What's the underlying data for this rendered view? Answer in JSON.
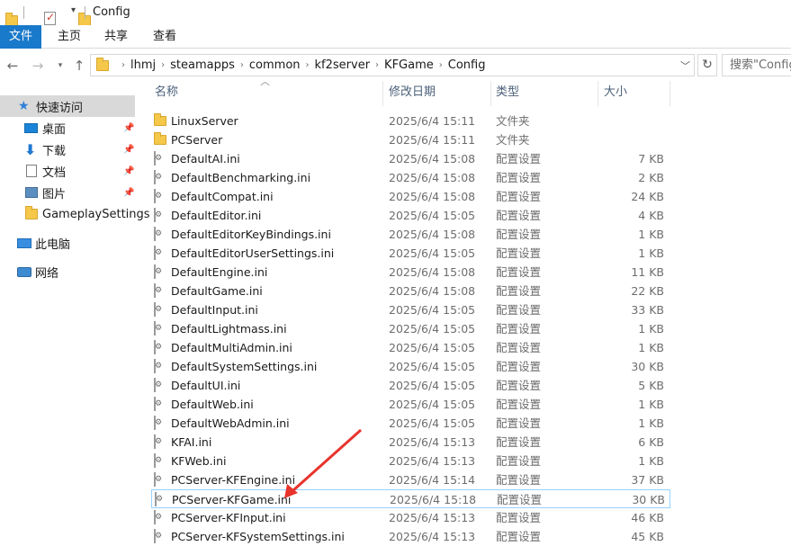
{
  "window": {
    "title": "Config"
  },
  "ribbon": {
    "tabs": [
      "文件",
      "主页",
      "共享",
      "查看"
    ]
  },
  "address": {
    "crumbs": [
      "lhmj",
      "steamapps",
      "common",
      "kf2server",
      "KFGame",
      "Config"
    ],
    "search_placeholder": "搜索\"Config\""
  },
  "sidebar": {
    "quick_access": "快速访问",
    "items": [
      {
        "label": "桌面",
        "icon": "desktop-icon",
        "pinned": true
      },
      {
        "label": "下载",
        "icon": "download-icon",
        "pinned": true
      },
      {
        "label": "文档",
        "icon": "documents-icon",
        "pinned": true
      },
      {
        "label": "图片",
        "icon": "pictures-icon",
        "pinned": true
      },
      {
        "label": "GameplaySettings",
        "icon": "folder-icon",
        "pinned": false
      }
    ],
    "this_pc": "此电脑",
    "network": "网络"
  },
  "columns": {
    "name": "名称",
    "date": "修改日期",
    "type": "类型",
    "size": "大小"
  },
  "files": [
    {
      "name": "LinuxServer",
      "date": "2025/6/4 15:11",
      "type": "文件夹",
      "size": "",
      "kind": "folder"
    },
    {
      "name": "PCServer",
      "date": "2025/6/4 15:11",
      "type": "文件夹",
      "size": "",
      "kind": "folder"
    },
    {
      "name": "DefaultAI.ini",
      "date": "2025/6/4 15:08",
      "type": "配置设置",
      "size": "7 KB",
      "kind": "ini"
    },
    {
      "name": "DefaultBenchmarking.ini",
      "date": "2025/6/4 15:08",
      "type": "配置设置",
      "size": "2 KB",
      "kind": "ini"
    },
    {
      "name": "DefaultCompat.ini",
      "date": "2025/6/4 15:08",
      "type": "配置设置",
      "size": "24 KB",
      "kind": "ini"
    },
    {
      "name": "DefaultEditor.ini",
      "date": "2025/6/4 15:05",
      "type": "配置设置",
      "size": "4 KB",
      "kind": "ini"
    },
    {
      "name": "DefaultEditorKeyBindings.ini",
      "date": "2025/6/4 15:08",
      "type": "配置设置",
      "size": "1 KB",
      "kind": "ini"
    },
    {
      "name": "DefaultEditorUserSettings.ini",
      "date": "2025/6/4 15:05",
      "type": "配置设置",
      "size": "1 KB",
      "kind": "ini"
    },
    {
      "name": "DefaultEngine.ini",
      "date": "2025/6/4 15:08",
      "type": "配置设置",
      "size": "11 KB",
      "kind": "ini"
    },
    {
      "name": "DefaultGame.ini",
      "date": "2025/6/4 15:08",
      "type": "配置设置",
      "size": "22 KB",
      "kind": "ini"
    },
    {
      "name": "DefaultInput.ini",
      "date": "2025/6/4 15:05",
      "type": "配置设置",
      "size": "33 KB",
      "kind": "ini"
    },
    {
      "name": "DefaultLightmass.ini",
      "date": "2025/6/4 15:05",
      "type": "配置设置",
      "size": "1 KB",
      "kind": "ini"
    },
    {
      "name": "DefaultMultiAdmin.ini",
      "date": "2025/6/4 15:05",
      "type": "配置设置",
      "size": "1 KB",
      "kind": "ini"
    },
    {
      "name": "DefaultSystemSettings.ini",
      "date": "2025/6/4 15:05",
      "type": "配置设置",
      "size": "30 KB",
      "kind": "ini"
    },
    {
      "name": "DefaultUI.ini",
      "date": "2025/6/4 15:05",
      "type": "配置设置",
      "size": "5 KB",
      "kind": "ini"
    },
    {
      "name": "DefaultWeb.ini",
      "date": "2025/6/4 15:05",
      "type": "配置设置",
      "size": "1 KB",
      "kind": "ini"
    },
    {
      "name": "DefaultWebAdmin.ini",
      "date": "2025/6/4 15:05",
      "type": "配置设置",
      "size": "1 KB",
      "kind": "ini"
    },
    {
      "name": "KFAI.ini",
      "date": "2025/6/4 15:13",
      "type": "配置设置",
      "size": "6 KB",
      "kind": "ini"
    },
    {
      "name": "KFWeb.ini",
      "date": "2025/6/4 15:13",
      "type": "配置设置",
      "size": "1 KB",
      "kind": "ini"
    },
    {
      "name": "PCServer-KFEngine.ini",
      "date": "2025/6/4 15:14",
      "type": "配置设置",
      "size": "37 KB",
      "kind": "ini"
    },
    {
      "name": "PCServer-KFGame.ini",
      "date": "2025/6/4 15:18",
      "type": "配置设置",
      "size": "30 KB",
      "kind": "ini",
      "selected": true
    },
    {
      "name": "PCServer-KFInput.ini",
      "date": "2025/6/4 15:13",
      "type": "配置设置",
      "size": "46 KB",
      "kind": "ini"
    },
    {
      "name": "PCServer-KFSystemSettings.ini",
      "date": "2025/6/4 15:13",
      "type": "配置设置",
      "size": "45 KB",
      "kind": "ini"
    }
  ],
  "annotation": {
    "arrow_color": "#e8332d"
  }
}
